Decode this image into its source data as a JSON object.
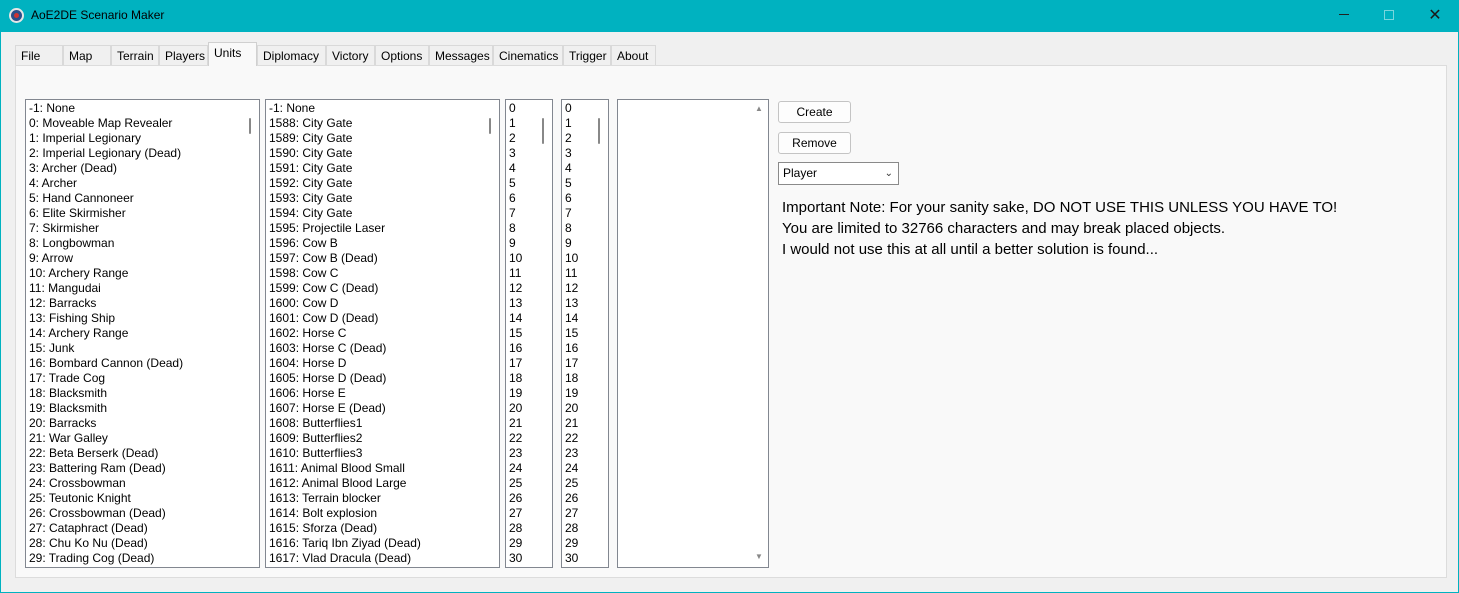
{
  "window": {
    "title": "AoE2DE Scenario Maker",
    "minimize": "",
    "maximize": "",
    "close": "✕"
  },
  "tabs": [
    "File",
    "Map",
    "Terrain",
    "Players",
    "Units",
    "Diplomacy",
    "Victory",
    "Options",
    "Messages",
    "Cinematics",
    "Trigger",
    "About"
  ],
  "active_tab": "Units",
  "unit_types": [
    "-1: None",
    "0: Moveable Map Revealer",
    "1: Imperial Legionary",
    "2: Imperial Legionary (Dead)",
    "3: Archer (Dead)",
    "4: Archer",
    "5: Hand Cannoneer",
    "6: Elite Skirmisher",
    "7: Skirmisher",
    "8: Longbowman",
    "9: Arrow",
    "10: Archery Range",
    "11: Mangudai",
    "12: Barracks",
    "13: Fishing Ship",
    "14: Archery Range",
    "15: Junk",
    "16: Bombard Cannon (Dead)",
    "17: Trade Cog",
    "18: Blacksmith",
    "19: Blacksmith",
    "20: Barracks",
    "21: War Galley",
    "22: Beta Berserk (Dead)",
    "23: Battering Ram (Dead)",
    "24: Crossbowman",
    "25: Teutonic Knight",
    "26: Crossbowman (Dead)",
    "27: Cataphract (Dead)",
    "28: Chu Ko Nu (Dead)",
    "29: Trading Cog (Dead)"
  ],
  "unit_types_2": [
    "-1: None",
    "1588: City Gate",
    "1589: City Gate",
    "1590: City Gate",
    "1591: City Gate",
    "1592: City Gate",
    "1593: City Gate",
    "1594: City Gate",
    "1595: Projectile Laser",
    "1596: Cow B",
    "1597: Cow B (Dead)",
    "1598: Cow C",
    "1599: Cow C (Dead)",
    "1600: Cow D",
    "1601: Cow D (Dead)",
    "1602: Horse C",
    "1603: Horse C (Dead)",
    "1604: Horse D",
    "1605: Horse D (Dead)",
    "1606: Horse E",
    "1607: Horse E (Dead)",
    "1608: Butterflies1",
    "1609: Butterflies2",
    "1610: Butterflies3",
    "1611: Animal Blood Small",
    "1612: Animal Blood Large",
    "1613: Terrain blocker",
    "1614: Bolt explosion",
    "1615: Sforza (Dead)",
    "1616: Tariq Ibn Ziyad (Dead)",
    "1617: Vlad Dracula (Dead)"
  ],
  "numbers_1": [
    "0",
    "1",
    "2",
    "3",
    "4",
    "5",
    "6",
    "7",
    "8",
    "9",
    "10",
    "11",
    "12",
    "13",
    "14",
    "15",
    "16",
    "17",
    "18",
    "19",
    "20",
    "21",
    "22",
    "23",
    "24",
    "25",
    "26",
    "27",
    "28",
    "29",
    "30"
  ],
  "numbers_2": [
    "0",
    "1",
    "2",
    "3",
    "4",
    "5",
    "6",
    "7",
    "8",
    "9",
    "10",
    "11",
    "12",
    "13",
    "14",
    "15",
    "16",
    "17",
    "18",
    "19",
    "20",
    "21",
    "22",
    "23",
    "24",
    "25",
    "26",
    "27",
    "28",
    "29",
    "30"
  ],
  "buttons": {
    "create": "Create",
    "remove": "Remove"
  },
  "player_select": {
    "value": "Player",
    "chevron": "⌄"
  },
  "note": {
    "line1": "Important Note: For your sanity sake, DO NOT USE THIS UNLESS YOU HAVE TO!",
    "line2": "You are limited to 32766 characters and may break placed objects.",
    "line3": "I would not use this at all until a better solution is found..."
  },
  "arrows": {
    "up": "▲",
    "down": "▼"
  }
}
